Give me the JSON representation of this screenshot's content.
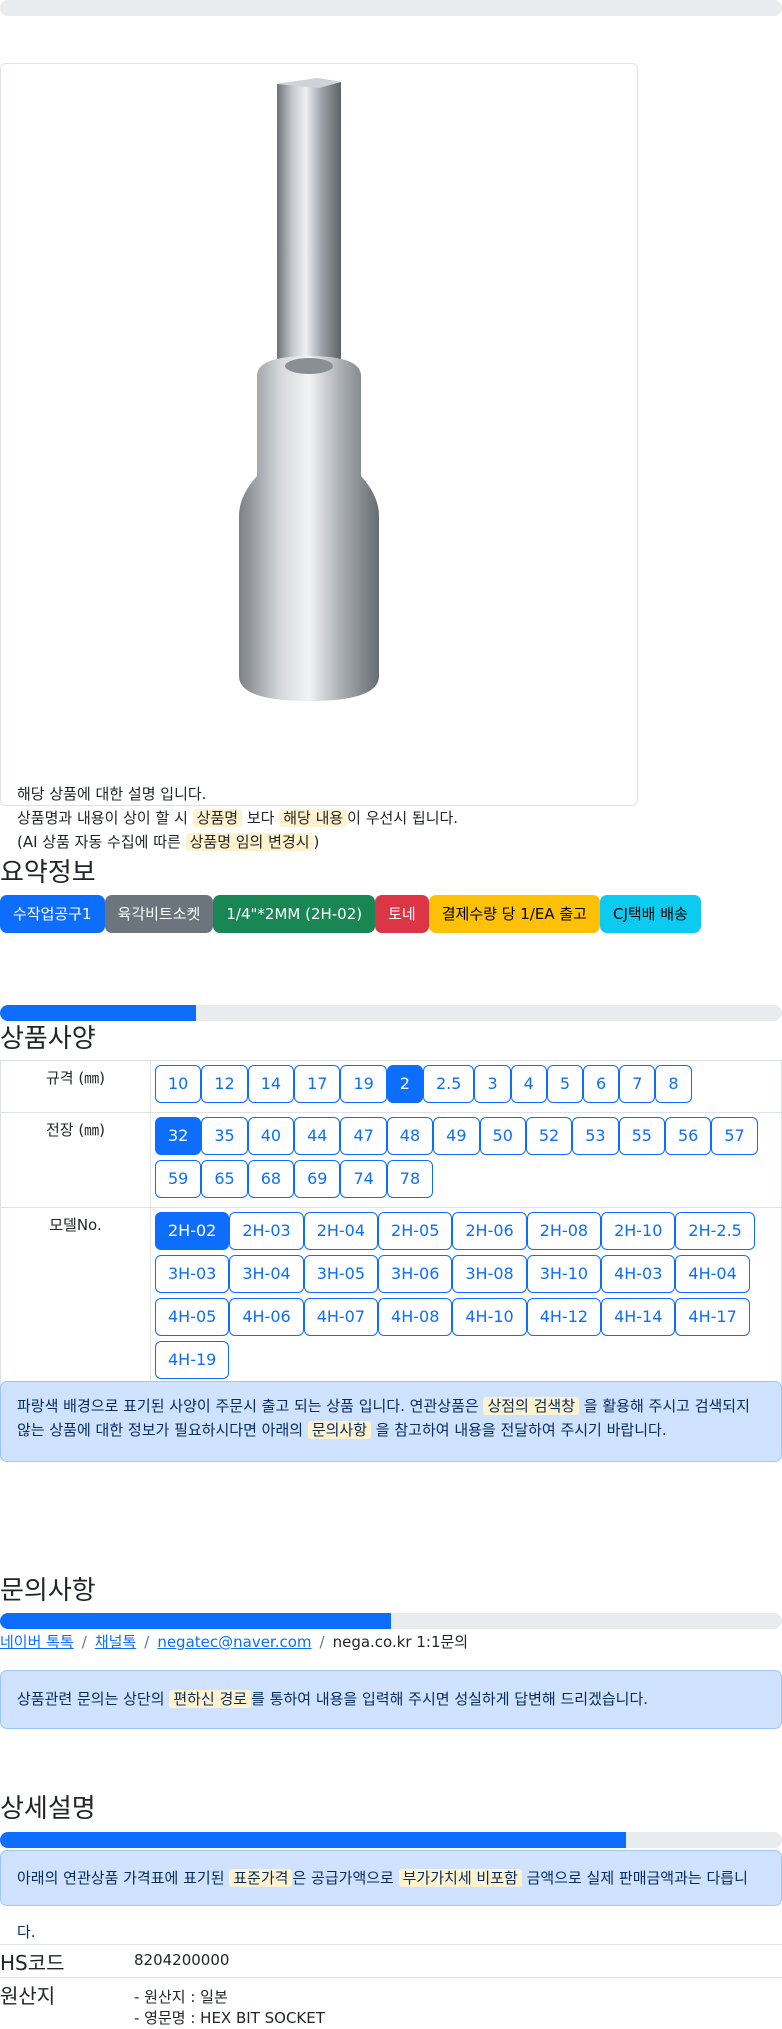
{
  "top_progress": {
    "percent": 0
  },
  "product": {
    "image_icon": "hex-bit-socket-image",
    "description_line1": "해당 상품에 대한 설명 입니다.",
    "description_line2": {
      "pre": "상품명과 내용이 상이 할 시 ",
      "hl1": "상품명",
      "mid": " 보다 ",
      "hl2": "해당 내용",
      "post": "이 우선시 됩니다."
    },
    "description_line3": {
      "pre": "(AI 상품 자동 수집에 따른 ",
      "hl": "상품명 임의 변경시",
      "post": ")"
    }
  },
  "summary": {
    "title": "요약정보",
    "badges": [
      {
        "label": "수작업공구1",
        "color": "#0d6efd"
      },
      {
        "label": "육각비트소켓",
        "color": "#6c757d"
      },
      {
        "label": "1/4\"*2MM (2H-02)",
        "color": "#198754"
      },
      {
        "label": "토네",
        "color": "#dc3545"
      },
      {
        "label": "결제수량 당 1/EA 출고",
        "color": "#ffc107"
      },
      {
        "label": "CJ택배 배송",
        "color": "#0dcaf0"
      }
    ]
  },
  "spec": {
    "progress_percent": 25,
    "title": "상품사양",
    "rows": [
      {
        "label": "규격 (㎜)",
        "options": [
          "10",
          "12",
          "14",
          "17",
          "19",
          "2",
          "2.5",
          "3",
          "4",
          "5",
          "6",
          "7",
          "8"
        ],
        "selected": "2"
      },
      {
        "label": "전장 (㎜)",
        "options": [
          "32",
          "35",
          "40",
          "44",
          "47",
          "48",
          "49",
          "50",
          "52",
          "53",
          "55",
          "56",
          "57",
          "59",
          "65",
          "68",
          "69",
          "74",
          "78"
        ],
        "selected": "32"
      },
      {
        "label": "모델No.",
        "options": [
          "2H-02",
          "2H-03",
          "2H-04",
          "2H-05",
          "2H-06",
          "2H-08",
          "2H-10",
          "2H-2.5",
          "3H-03",
          "3H-04",
          "3H-05",
          "3H-06",
          "3H-08",
          "3H-10",
          "4H-03",
          "4H-04",
          "4H-05",
          "4H-06",
          "4H-07",
          "4H-08",
          "4H-10",
          "4H-12",
          "4H-14",
          "4H-17",
          "4H-19"
        ],
        "selected": "2H-02"
      }
    ],
    "notice": {
      "pre": "파랑색 배경으로 표기된 사양이 주문시 출고 되는 상품 입니다. 연관상품은 ",
      "hl1": "상점의 검색창",
      "mid": " 을 활용해 주시고 검색되지 않는 상품에 대한 정보가 필요하시다면 아래의 ",
      "hl2": "문의사항",
      "post": " 을 참고하여 내용을 전달하여 주시기 바랍니다."
    }
  },
  "inquiry": {
    "title": "문의사항",
    "progress_percent": 50,
    "links": [
      "네이버 톡톡",
      "채널톡",
      "negatec@naver.com"
    ],
    "site_text": "nega.co.kr 1:1문의",
    "notice": {
      "pre": "상품관련 문의는 상단의 ",
      "hl": "편하신 경로",
      "post": "를 통하여 내용을 입력해 주시면 성실하게 답변해 드리겠습니다."
    }
  },
  "detail": {
    "title": "상세설명",
    "progress_percent": 80,
    "notice": {
      "pre": "아래의 연관상품 가격표에 표기된 ",
      "hl1": "표준가격",
      "mid": "은 공급가액으로 ",
      "hl2": "부가가치세 비포함",
      "post": " 금액으로 실제 판매금액과는 다릅니다."
    }
  },
  "info": {
    "hs_label": "HS코드",
    "hs_value": "8204200000",
    "origin_label": "원산지",
    "origin_line1": "- 원산지 : 일본",
    "origin_line2": "- 영문명 : HEX BIT SOCKET"
  }
}
